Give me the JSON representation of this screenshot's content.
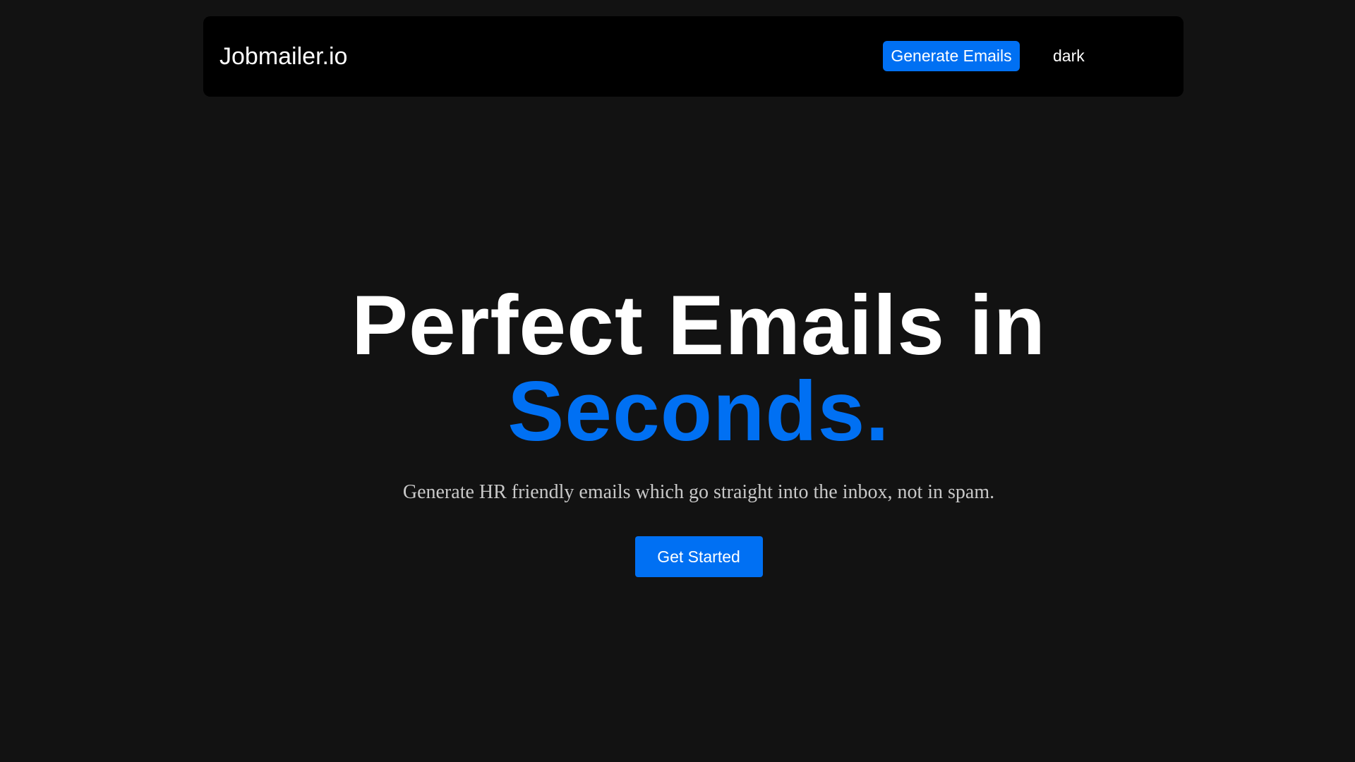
{
  "navbar": {
    "brand": "Jobmailer.io",
    "generate_button_label": "Generate Emails",
    "theme_toggle_label": "dark"
  },
  "hero": {
    "headline_line1": "Perfect Emails in",
    "headline_line2": "Seconds.",
    "subtitle": "Generate HR friendly emails which go straight into the inbox, not in spam.",
    "cta_label": "Get Started"
  },
  "colors": {
    "background": "#121212",
    "navbar_background": "#000000",
    "accent": "#0070f3",
    "text": "#ffffff",
    "subtitle_text": "#c8c8c8"
  }
}
